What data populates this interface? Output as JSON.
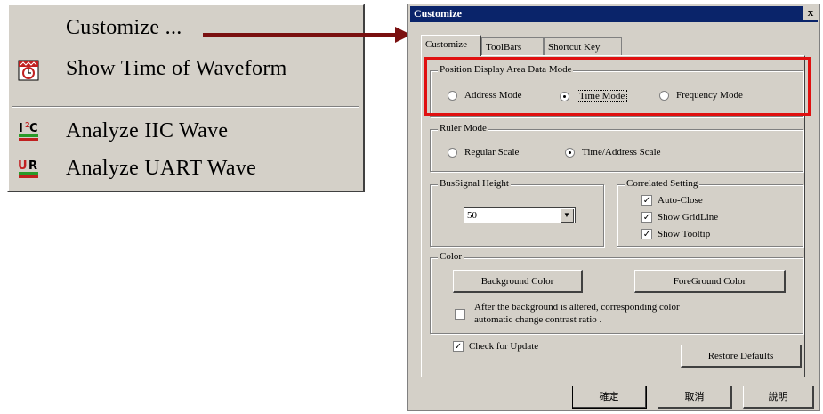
{
  "menu": {
    "items": [
      {
        "label": "Customize ...",
        "icon": "none"
      },
      {
        "label": "Show Time of Waveform",
        "icon": "waveform-clock-icon"
      },
      {
        "label": "Analyze IIC Wave",
        "icon": "i2c-icon"
      },
      {
        "label": "Analyze UART Wave",
        "icon": "uart-icon"
      }
    ]
  },
  "dialog": {
    "title": "Customize",
    "close": "x",
    "tabs": [
      "Customize",
      "ToolBars",
      "Shortcut Key"
    ],
    "display_group": {
      "label": "Position Display Area Data Mode",
      "options": [
        "Address Mode",
        "Time Mode",
        "Frequency Mode"
      ],
      "selected": "Time Mode"
    },
    "ruler_group": {
      "label": "Ruler Mode",
      "options": [
        "Regular Scale",
        "Time/Address Scale"
      ],
      "selected": "Time/Address Scale"
    },
    "bus_group": {
      "label": "BusSignal Height",
      "value": "50"
    },
    "correlated_group": {
      "label": "Correlated Setting",
      "items": [
        {
          "label": "Auto-Close",
          "checked": true
        },
        {
          "label": "Show GridLine",
          "checked": true
        },
        {
          "label": "Show Tooltip",
          "checked": true
        }
      ]
    },
    "color_group": {
      "label": "Color",
      "background_btn": "Background Color",
      "foreground_btn": "ForeGround Color",
      "contrast_text_1": "After the background is altered, corresponding color",
      "contrast_text_2": "automatic change contrast ratio ."
    },
    "check_update": "Check for Update",
    "restore_btn": "Restore Defaults",
    "ok_btn": "確定",
    "cancel_btn": "取消",
    "help_btn": "說明"
  },
  "colors": {
    "highlight": "#e01010",
    "arrow": "#7a1010",
    "titlebar": "#0a246a"
  }
}
